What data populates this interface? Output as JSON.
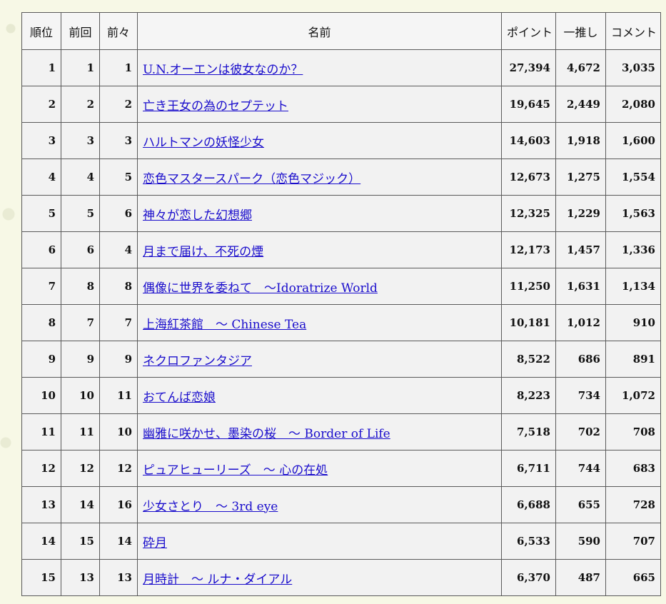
{
  "table": {
    "headers": {
      "rank": "順位",
      "prev": "前回",
      "prev2": "前々",
      "name": "名前",
      "points": "ポイント",
      "oshi": "一推し",
      "comment": "コメント"
    },
    "rows": [
      {
        "rank": "1",
        "prev": "1",
        "prev2": "1",
        "name": "U.N.オーエンは彼女なのか？",
        "points": "27,394",
        "oshi": "4,672",
        "comment": "3,035"
      },
      {
        "rank": "2",
        "prev": "2",
        "prev2": "2",
        "name": "亡き王女の為のセプテット",
        "points": "19,645",
        "oshi": "2,449",
        "comment": "2,080"
      },
      {
        "rank": "3",
        "prev": "3",
        "prev2": "3",
        "name": "ハルトマンの妖怪少女",
        "points": "14,603",
        "oshi": "1,918",
        "comment": "1,600"
      },
      {
        "rank": "4",
        "prev": "4",
        "prev2": "5",
        "name": "恋色マスタースパーク（恋色マジック）",
        "points": "12,673",
        "oshi": "1,275",
        "comment": "1,554"
      },
      {
        "rank": "5",
        "prev": "5",
        "prev2": "6",
        "name": "神々が恋した幻想郷",
        "points": "12,325",
        "oshi": "1,229",
        "comment": "1,563"
      },
      {
        "rank": "6",
        "prev": "6",
        "prev2": "4",
        "name": "月まで届け、不死の煙",
        "points": "12,173",
        "oshi": "1,457",
        "comment": "1,336"
      },
      {
        "rank": "7",
        "prev": "8",
        "prev2": "8",
        "name": "偶像に世界を委ねて　～Idoratrize World",
        "points": "11,250",
        "oshi": "1,631",
        "comment": "1,134"
      },
      {
        "rank": "8",
        "prev": "7",
        "prev2": "7",
        "name": "上海紅茶館　～ Chinese Tea",
        "points": "10,181",
        "oshi": "1,012",
        "comment": "910"
      },
      {
        "rank": "9",
        "prev": "9",
        "prev2": "9",
        "name": "ネクロファンタジア",
        "points": "8,522",
        "oshi": "686",
        "comment": "891"
      },
      {
        "rank": "10",
        "prev": "10",
        "prev2": "11",
        "name": "おてんば恋娘",
        "points": "8,223",
        "oshi": "734",
        "comment": "1,072"
      },
      {
        "rank": "11",
        "prev": "11",
        "prev2": "10",
        "name": "幽雅に咲かせ、墨染の桜　～ Border of Life",
        "points": "7,518",
        "oshi": "702",
        "comment": "708"
      },
      {
        "rank": "12",
        "prev": "12",
        "prev2": "12",
        "name": "ピュアヒューリーズ　～ 心の在処",
        "points": "6,711",
        "oshi": "744",
        "comment": "683"
      },
      {
        "rank": "13",
        "prev": "14",
        "prev2": "16",
        "name": "少女さとり　～ 3rd eye",
        "points": "6,688",
        "oshi": "655",
        "comment": "728"
      },
      {
        "rank": "14",
        "prev": "15",
        "prev2": "14",
        "name": "砕月",
        "points": "6,533",
        "oshi": "590",
        "comment": "707"
      },
      {
        "rank": "15",
        "prev": "13",
        "prev2": "13",
        "name": "月時計　～ ルナ・ダイアル",
        "points": "6,370",
        "oshi": "487",
        "comment": "665"
      }
    ]
  },
  "colors": {
    "page_background": "#f7f8e6",
    "cell_background": "#f2f2f2",
    "header_background": "#f5f5f5",
    "link": "#1a0dcc",
    "border": "#5a5a5a"
  }
}
